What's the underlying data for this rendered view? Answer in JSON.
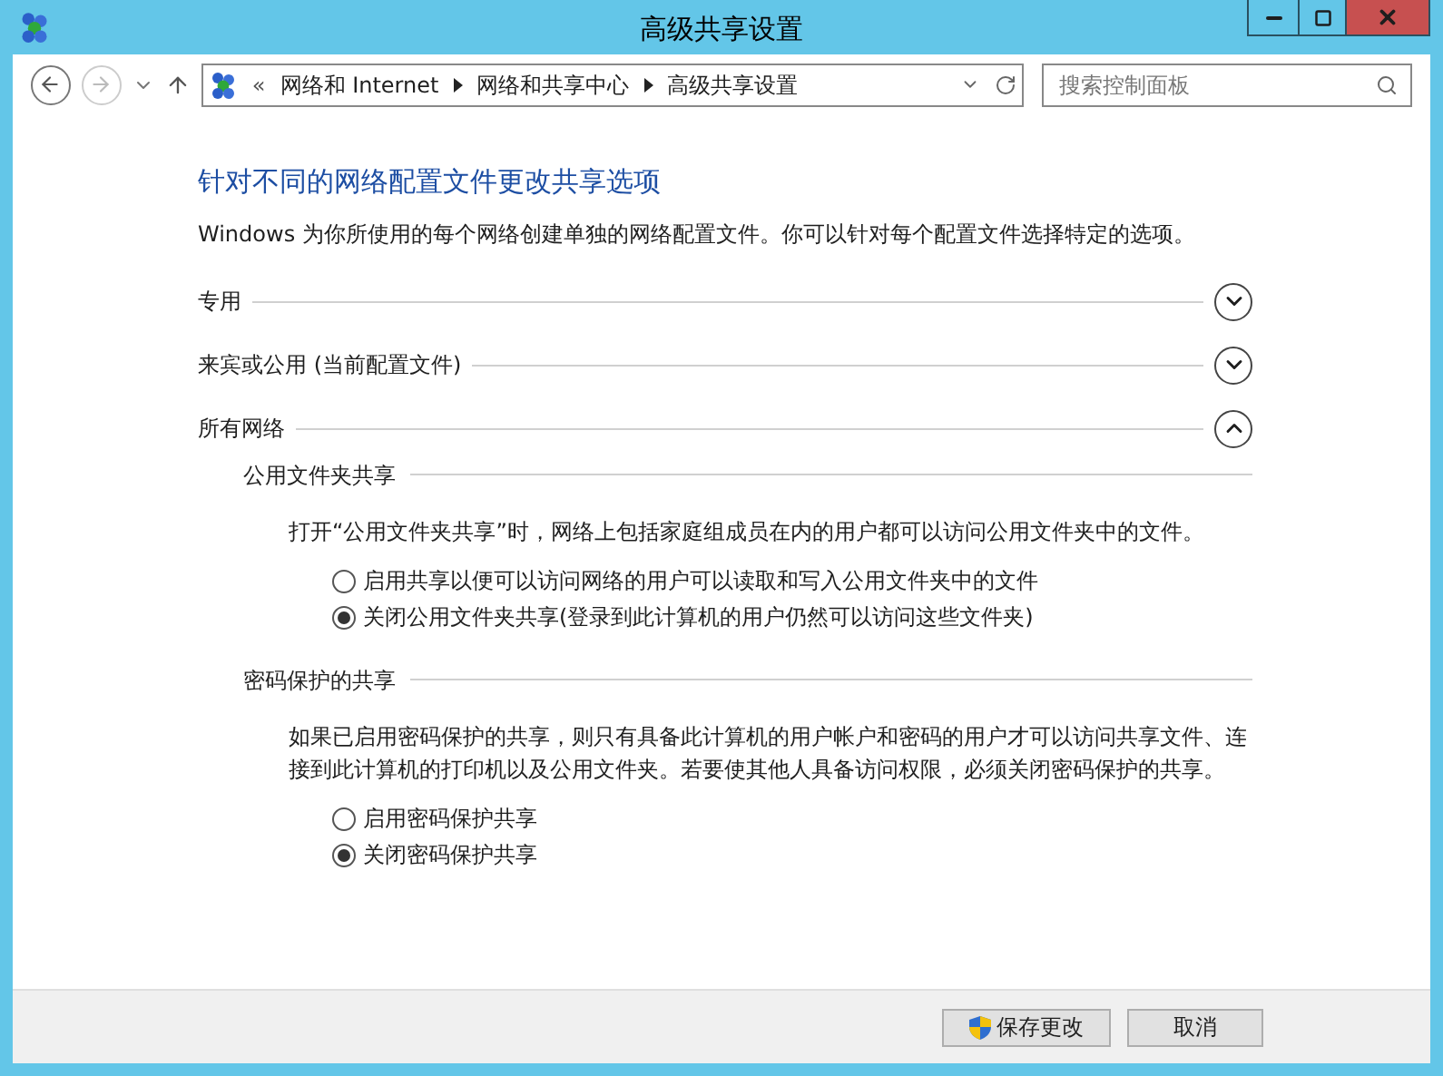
{
  "window": {
    "title": "高级共享设置"
  },
  "address_bar": {
    "prefix": "«",
    "crumbs": [
      "网络和 Internet",
      "网络和共享中心",
      "高级共享设置"
    ]
  },
  "search": {
    "placeholder": "搜索控制面板"
  },
  "heading": "针对不同的网络配置文件更改共享选项",
  "intro": "Windows 为你所使用的每个网络创建单独的网络配置文件。你可以针对每个配置文件选择特定的选项。",
  "profiles": [
    {
      "label": "专用",
      "expanded": false
    },
    {
      "label": "来宾或公用 (当前配置文件)",
      "expanded": false
    },
    {
      "label": "所有网络",
      "expanded": true,
      "groups": [
        {
          "title": "公用文件夹共享",
          "description": "打开“公用文件夹共享”时，网络上包括家庭组成员在内的用户都可以访问公用文件夹中的文件。",
          "options": [
            {
              "label": "启用共享以便可以访问网络的用户可以读取和写入公用文件夹中的文件",
              "selected": false
            },
            {
              "label": "关闭公用文件夹共享(登录到此计算机的用户仍然可以访问这些文件夹)",
              "selected": true
            }
          ]
        },
        {
          "title": "密码保护的共享",
          "description": "如果已启用密码保护的共享，则只有具备此计算机的用户帐户和密码的用户才可以访问共享文件、连接到此计算机的打印机以及公用文件夹。若要使其他人具备访问权限，必须关闭密码保护的共享。",
          "options": [
            {
              "label": "启用密码保护共享",
              "selected": false
            },
            {
              "label": "关闭密码保护共享",
              "selected": true
            }
          ]
        }
      ]
    }
  ],
  "buttons": [
    {
      "label": "保存更改",
      "kind": "shield"
    },
    {
      "label": "取消",
      "kind": "plain"
    }
  ]
}
